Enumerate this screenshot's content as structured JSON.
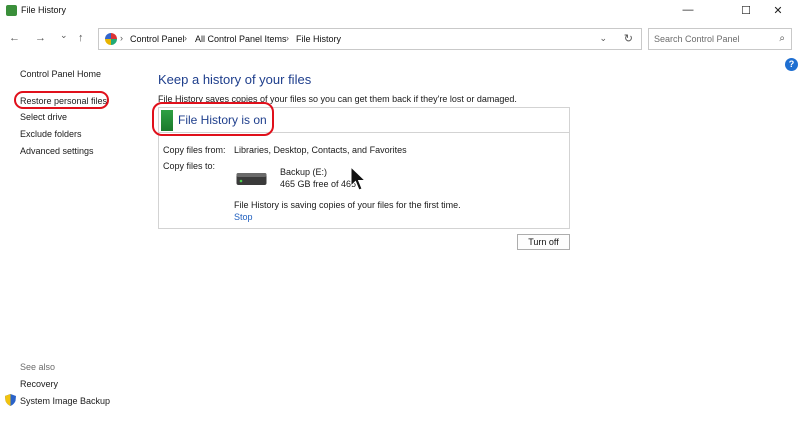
{
  "window": {
    "title": "File History",
    "controls": {
      "minimize": "—",
      "maximize": "☐",
      "close": "✕"
    }
  },
  "nav": {
    "back": "←",
    "forward": "→",
    "recent": "⌄",
    "up": "↑",
    "breadcrumbs": [
      "Control Panel",
      "All Control Panel Items",
      "File History"
    ],
    "separator": "›",
    "dropdown": "⌄",
    "refresh": "↻",
    "search_placeholder": "Search Control Panel",
    "search_icon": "⌕"
  },
  "help": {
    "label": "?"
  },
  "sidebar": {
    "home": "Control Panel Home",
    "items": [
      "Restore personal files",
      "Select drive",
      "Exclude folders",
      "Advanced settings"
    ],
    "see_also_title": "See also",
    "see_also_items": [
      "Recovery",
      "System Image Backup"
    ]
  },
  "main": {
    "heading": "Keep a history of your files",
    "description": "File History saves copies of your files so you can get them back if they're lost or damaged.",
    "status_title": "File History is on",
    "copy_from_label": "Copy files from:",
    "copy_from_value": "Libraries, Desktop, Contacts, and Favorites",
    "copy_to_label": "Copy files to:",
    "drive_name": "Backup (E:)",
    "drive_free": "465 GB free of 465",
    "saving_message": "File History is saving copies of your files for the first time.",
    "stop_link": "Stop",
    "turn_off_button": "Turn off"
  },
  "colors": {
    "accent_heading": "#1e3e8c",
    "link": "#1f5fbf",
    "highlight_circle": "#e0101b",
    "status_green": "#2ea043"
  },
  "icons": {
    "app": "file-history-icon",
    "control_panel": "control-panel-icon",
    "drive": "hard-drive-icon",
    "shield": "uac-shield-icon",
    "cursor": "mouse-pointer-icon"
  }
}
